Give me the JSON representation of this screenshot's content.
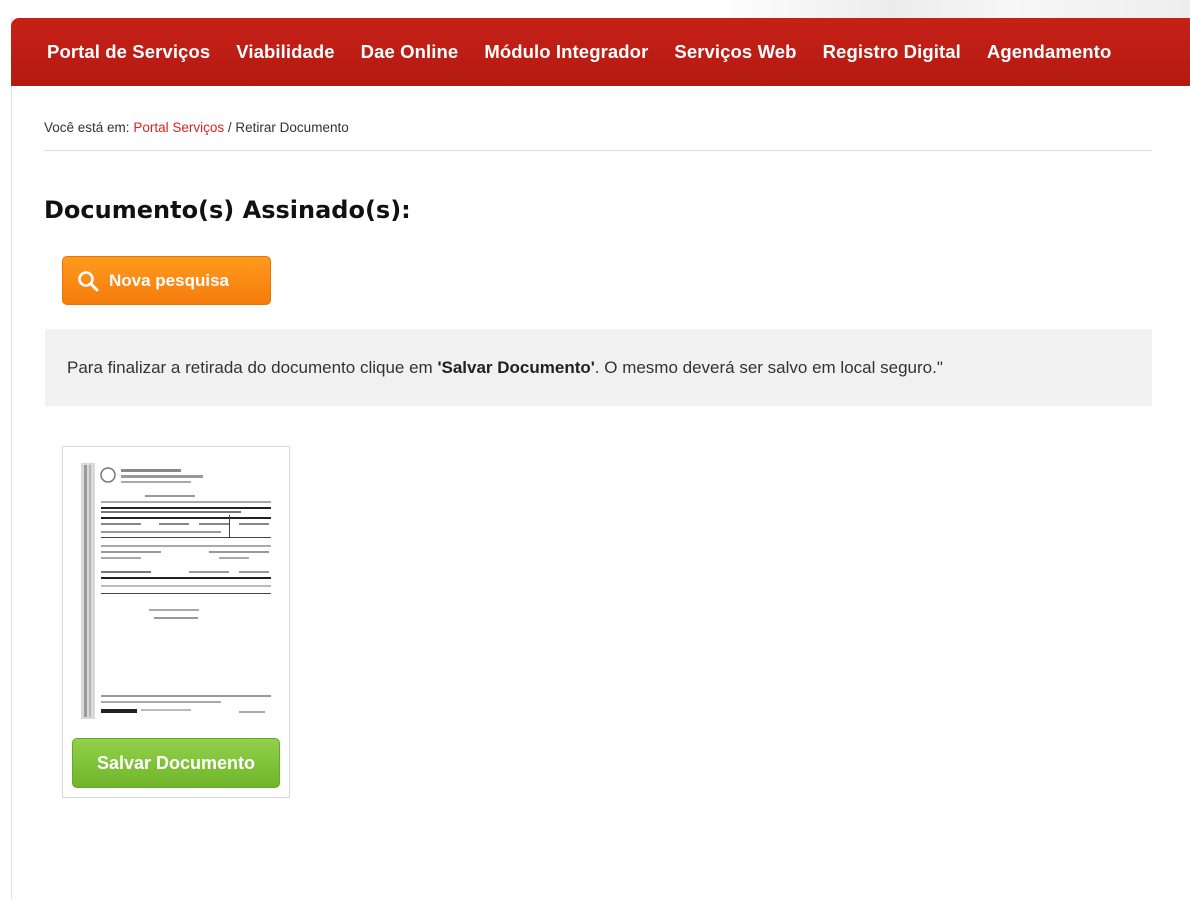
{
  "nav": {
    "items": [
      "Portal de Serviços",
      "Viabilidade",
      "Dae Online",
      "Módulo Integrador",
      "Serviços Web",
      "Registro Digital",
      "Agendamento"
    ]
  },
  "breadcrumb": {
    "prefix": "Você está em:",
    "link": "Portal Serviços",
    "separator": "/",
    "current": "Retirar Documento"
  },
  "page": {
    "title": "Documento(s) Assinado(s):"
  },
  "search_button": {
    "label": "Nova pesquisa",
    "icon": "search-icon"
  },
  "notice": {
    "before": "Para finalizar a retirada do documento clique em ",
    "emphasis": "'Salvar Documento'",
    "after": ". O mesmo deverá ser salvo em local seguro.\""
  },
  "document": {
    "save_label": "Salvar Documento"
  },
  "colors": {
    "nav_bg": "#c01f15",
    "search_button": "#f7860f",
    "save_button": "#7dc13a",
    "breadcrumb_link": "#dd2222",
    "notice_bg": "#f1f1f1"
  }
}
